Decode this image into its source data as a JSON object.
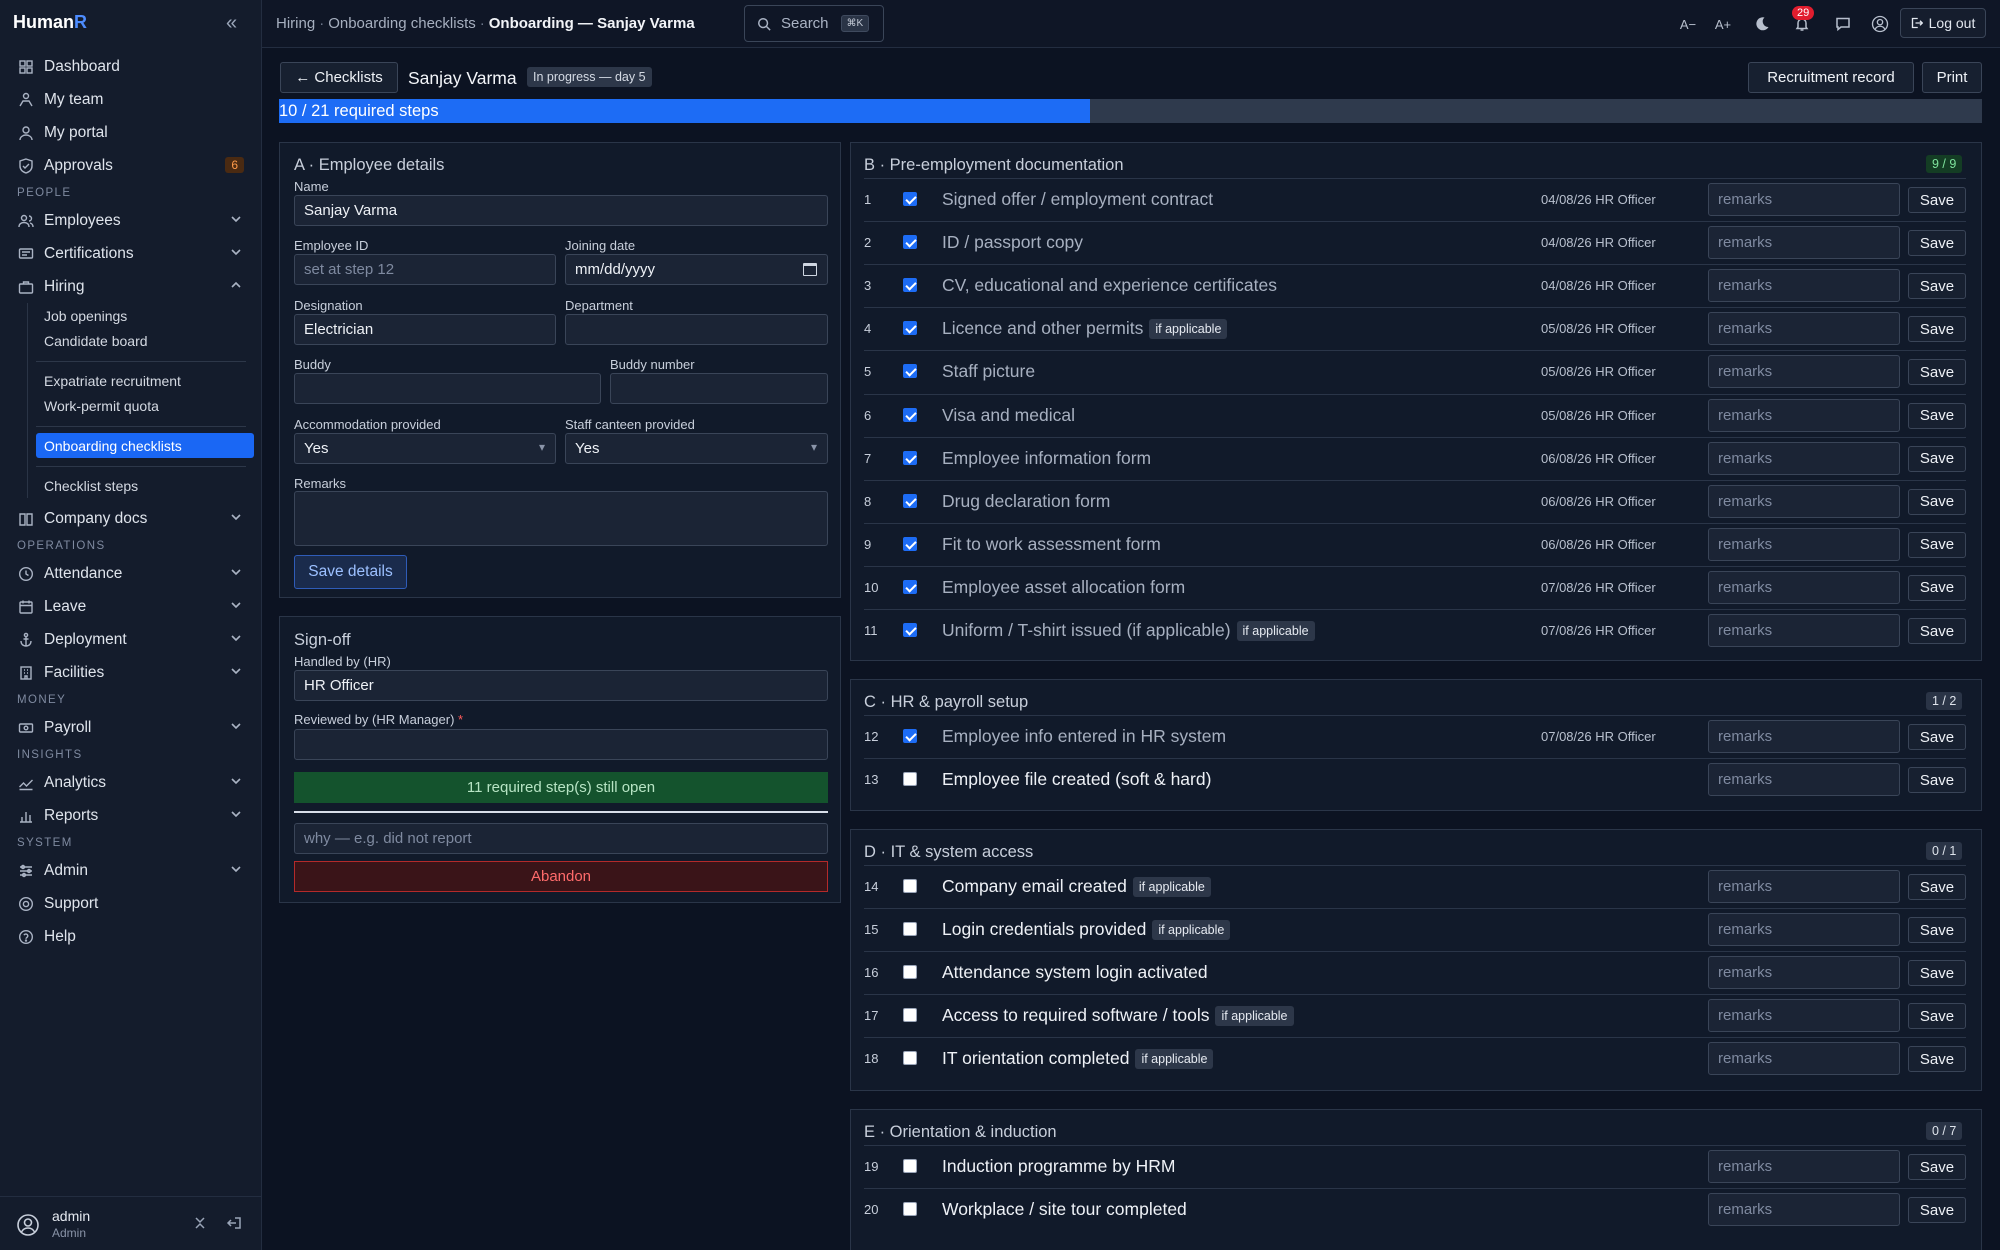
{
  "brand": {
    "name": "Human",
    "accent_letter": "R"
  },
  "sidebar": {
    "items_top": [
      {
        "label": "Dashboard",
        "icon": "grid-icon"
      },
      {
        "label": "My team",
        "icon": "team-icon"
      },
      {
        "label": "My portal",
        "icon": "person-icon"
      },
      {
        "label": "Approvals",
        "icon": "shield-check-icon",
        "badge": "6"
      }
    ],
    "section_people": "PEOPLE",
    "employees": "Employees",
    "certifications": "Certifications",
    "hiring": "Hiring",
    "hiring_sub": {
      "job_openings": "Job openings",
      "candidate_board": "Candidate board",
      "expatriate_recruitment": "Expatriate recruitment",
      "work_permit_quota": "Work-permit quota",
      "onboarding_checklists": "Onboarding checklists",
      "checklist_steps": "Checklist steps"
    },
    "company_docs": "Company docs",
    "section_operations": "OPERATIONS",
    "attendance": "Attendance",
    "leave": "Leave",
    "deployment": "Deployment",
    "facilities": "Facilities",
    "section_money": "MONEY",
    "payroll": "Payroll",
    "section_insights": "INSIGHTS",
    "analytics": "Analytics",
    "reports": "Reports",
    "section_system": "SYSTEM",
    "admin": "Admin",
    "support": "Support",
    "help": "Help",
    "user": {
      "name": "admin",
      "role": "Admin"
    }
  },
  "topbar": {
    "crumb1": "Hiring",
    "crumb2": "Onboarding checklists",
    "crumb3": "Onboarding — Sanjay Varma",
    "search_label": "Search",
    "search_kbd": "⌘K",
    "font_smaller": "A−",
    "font_larger": "A+",
    "notifications_count": "29",
    "logout": "Log out"
  },
  "header": {
    "back": "← Checklists",
    "employee_name": "Sanjay Varma",
    "status": "In progress — day 5",
    "recruitment_record": "Recruitment record",
    "print": "Print"
  },
  "progress": {
    "label": "10 / 21 required steps",
    "done": 10,
    "total": 21
  },
  "details": {
    "title": "A · Employee details",
    "name_label": "Name",
    "name_value": "Sanjay Varma",
    "employee_id_label": "Employee ID",
    "employee_id_placeholder": "set at step 12",
    "joining_date_label": "Joining date",
    "joining_date_placeholder": "mm/dd/yyyy",
    "designation_label": "Designation",
    "designation_value": "Electrician",
    "department_label": "Department",
    "department_value": "",
    "buddy_label": "Buddy",
    "buddy_value": "",
    "buddy_number_label": "Buddy number",
    "buddy_number_value": "",
    "accommodation_label": "Accommodation provided",
    "accommodation_value": "Yes",
    "canteen_label": "Staff canteen provided",
    "canteen_value": "Yes",
    "remarks_label": "Remarks",
    "save": "Save details"
  },
  "signoff": {
    "title": "Sign-off",
    "handled_label": "Handled by (HR)",
    "handled_value": "HR Officer",
    "reviewed_label": "Reviewed by (HR Manager)",
    "required_mark": "*",
    "open_steps": "11 required step(s) still open",
    "abandon_placeholder": "why — e.g. did not report",
    "abandon": "Abandon"
  },
  "remarks_placeholder": "remarks",
  "save_label": "Save",
  "sections": [
    {
      "title": "B · Pre-employment documentation",
      "count": "9 / 9",
      "complete": true,
      "rows": [
        {
          "n": "1",
          "label": "Signed offer / employment contract",
          "checked": true,
          "meta": "04/08/26 HR Officer"
        },
        {
          "n": "2",
          "label": "ID / passport copy",
          "checked": true,
          "meta": "04/08/26 HR Officer"
        },
        {
          "n": "3",
          "label": "CV, educational and experience certificates",
          "checked": true,
          "meta": "04/08/26 HR Officer"
        },
        {
          "n": "4",
          "label": "Licence and other permits",
          "tag": "if applicable",
          "checked": true,
          "meta": "05/08/26 HR Officer"
        },
        {
          "n": "5",
          "label": "Staff picture",
          "checked": true,
          "meta": "05/08/26 HR Officer"
        },
        {
          "n": "6",
          "label": "Visa and medical",
          "checked": true,
          "meta": "05/08/26 HR Officer"
        },
        {
          "n": "7",
          "label": "Employee information form",
          "checked": true,
          "meta": "06/08/26 HR Officer"
        },
        {
          "n": "8",
          "label": "Drug declaration form",
          "checked": true,
          "meta": "06/08/26 HR Officer"
        },
        {
          "n": "9",
          "label": "Fit to work assessment form",
          "checked": true,
          "meta": "06/08/26 HR Officer"
        },
        {
          "n": "10",
          "label": "Employee asset allocation form",
          "checked": true,
          "meta": "07/08/26 HR Officer"
        },
        {
          "n": "11",
          "label": "Uniform / T-shirt issued (if applicable)",
          "tag": "if applicable",
          "checked": true,
          "meta": "07/08/26 HR Officer"
        }
      ]
    },
    {
      "title": "C · HR & payroll setup",
      "count": "1 / 2",
      "complete": false,
      "rows": [
        {
          "n": "12",
          "label": "Employee info entered in HR system",
          "checked": true,
          "meta": "07/08/26 HR Officer"
        },
        {
          "n": "13",
          "label": "Employee file created (soft & hard)",
          "checked": false,
          "meta": ""
        }
      ]
    },
    {
      "title": "D · IT & system access",
      "count": "0 / 1",
      "complete": false,
      "rows": [
        {
          "n": "14",
          "label": "Company email created",
          "tag": "if applicable",
          "checked": false,
          "meta": ""
        },
        {
          "n": "15",
          "label": "Login credentials provided",
          "tag": "if applicable",
          "checked": false,
          "meta": ""
        },
        {
          "n": "16",
          "label": "Attendance system login activated",
          "checked": false,
          "meta": ""
        },
        {
          "n": "17",
          "label": "Access to required software / tools",
          "tag": "if applicable",
          "checked": false,
          "meta": ""
        },
        {
          "n": "18",
          "label": "IT orientation completed",
          "tag": "if applicable",
          "checked": false,
          "meta": ""
        }
      ]
    },
    {
      "title": "E · Orientation & induction",
      "count": "0 / 7",
      "complete": false,
      "rows": [
        {
          "n": "19",
          "label": "Induction programme by HRM",
          "checked": false,
          "meta": ""
        },
        {
          "n": "20",
          "label": "Workplace / site tour completed",
          "checked": false,
          "meta": ""
        }
      ]
    }
  ]
}
